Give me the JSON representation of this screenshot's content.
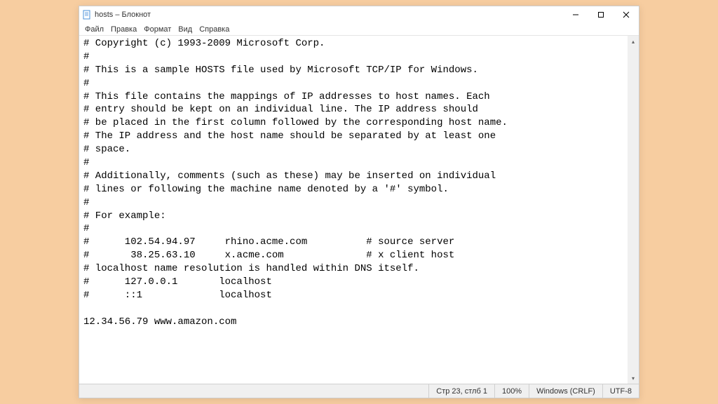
{
  "titlebar": {
    "title": "hosts – Блокнот"
  },
  "menu": {
    "file": "Файл",
    "edit": "Правка",
    "format": "Формат",
    "view": "Вид",
    "help": "Справка"
  },
  "editor": {
    "content": "# Copyright (c) 1993-2009 Microsoft Corp.\n#\n# This is a sample HOSTS file used by Microsoft TCP/IP for Windows.\n#\n# This file contains the mappings of IP addresses to host names. Each\n# entry should be kept on an individual line. The IP address should\n# be placed in the first column followed by the corresponding host name.\n# The IP address and the host name should be separated by at least one\n# space.\n#\n# Additionally, comments (such as these) may be inserted on individual\n# lines or following the machine name denoted by a '#' symbol.\n#\n# For example:\n#\n#      102.54.94.97     rhino.acme.com          # source server\n#       38.25.63.10     x.acme.com              # x client host\n# localhost name resolution is handled within DNS itself.\n#      127.0.0.1       localhost\n#      ::1             localhost\n\n12.34.56.79 www.amazon.com"
  },
  "statusbar": {
    "position": "Стр 23, стлб 1",
    "zoom": "100%",
    "line_ending": "Windows (CRLF)",
    "encoding": "UTF-8"
  }
}
